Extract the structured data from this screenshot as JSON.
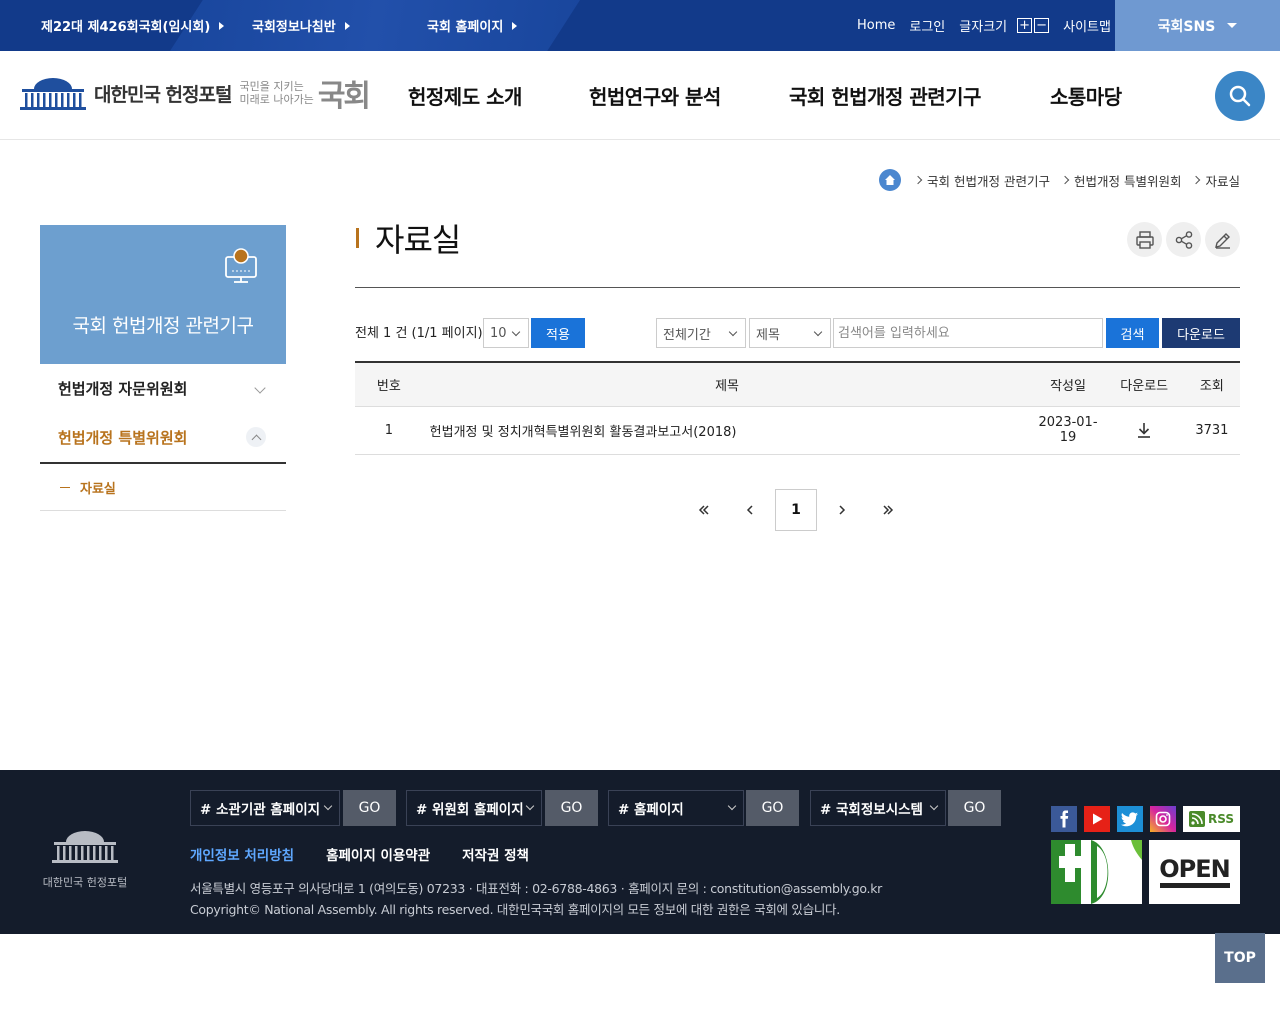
{
  "topbar": {
    "links": [
      {
        "label": "제22대 제426회국회(임시회)"
      },
      {
        "label": "국회정보나침반"
      },
      {
        "label": "국회 홈페이지"
      }
    ],
    "home": "Home",
    "login": "로그인",
    "font_size": "글자크기",
    "font_plus": "+",
    "font_minus": "−",
    "sitemap": "사이트맵",
    "sns": "국회SNS"
  },
  "header": {
    "logo_text": "대한민국 헌정포털",
    "slogan_line1": "국민을 지키는",
    "slogan_line2": "미래로 나아가는",
    "slogan_big": "국회",
    "nav": [
      "헌정제도 소개",
      "헌법연구와 분석",
      "국회 헌법개정 관련기구",
      "소통마당"
    ]
  },
  "breadcrumb": [
    "국회 헌법개정 관련기구",
    "헌법개정 특별위원회",
    "자료실"
  ],
  "side": {
    "title": "국회 헌법개정 관련기구",
    "items": [
      {
        "label": "헌법개정 자문위원회",
        "color": "#222222"
      },
      {
        "label": "헌법개정 특별위원회",
        "color": "#b8731d"
      }
    ],
    "sub": "자료실"
  },
  "page": {
    "title": "자료실",
    "count_text": "전체 1 건 (1/1 페이지)",
    "page_size": "10",
    "apply": "적용",
    "period": "전체기간",
    "field": "제목",
    "search_placeholder": "검색어를 입력하세요",
    "search": "검색",
    "download": "다운로드"
  },
  "table": {
    "headers": [
      "번호",
      "제목",
      "작성일",
      "다운로드",
      "조회"
    ],
    "rows": [
      {
        "no": "1",
        "title": "헌법개정 및 정치개혁특별위원회 활동결과보고서(2018)",
        "date": "2023-01-19",
        "views": "3731"
      }
    ]
  },
  "pagination": {
    "current": "1"
  },
  "footer": {
    "logo_text": "대한민국 헌정포털",
    "selects": [
      {
        "label": "# 소관기관 홈페이지",
        "go": "GO"
      },
      {
        "label": "# 위원회 홈페이지",
        "go": "GO"
      },
      {
        "label": "# 홈페이지",
        "go": "GO"
      },
      {
        "label": "# 국회정보시스템",
        "go": "GO"
      }
    ],
    "links": [
      {
        "label": "개인정보 처리방침",
        "color": "#5fa8ff"
      },
      {
        "label": "홈페이지 이용약관",
        "color": "#ffffff"
      },
      {
        "label": "저작권 정책",
        "color": "#ffffff"
      }
    ],
    "address": "서울특별시 영등포구 의사당대로 1 (여의도동) 07233 · 대표전화 : 02-6788-4863 · 홈페이지 문의 : constitution@assembly.go.kr",
    "copyright": "Copyright© National Assembly. All rights reserved. 대한민국국회 홈페이지의 모든 정보에 대한 권한은 국회에 있습니다.",
    "rss": "RSS",
    "open": "OPEN"
  },
  "top_button": "TOP",
  "colors": {
    "topbar": "#123a8a",
    "accent": "#b8731d",
    "primary_button": "#1a73d9",
    "download_button": "#1d3a73",
    "footer": "#141c2b"
  }
}
